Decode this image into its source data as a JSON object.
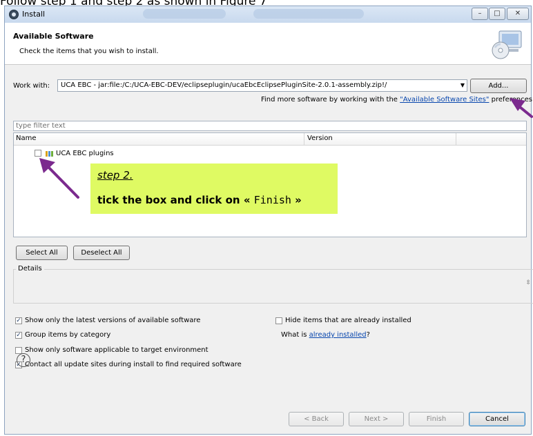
{
  "caption": "Follow step 1 and step 2 as shown in Figure 7",
  "window": {
    "title": "Install",
    "minimize": "–",
    "maximize": "□",
    "close": "✕"
  },
  "header": {
    "title": "Available Software",
    "description": "Check the items that you wish to install."
  },
  "work_with": {
    "label": "Work with:",
    "value": "UCA EBC - jar:file:/C:/UCA-EBC-DEV/eclipseplugin/ucaEbcEclipsePluginSite-2.0.1-assembly.zip!/",
    "add_button": "Add...",
    "hint_prefix": "Find more software by working with the",
    "hint_link": "\"Available Software Sites\"",
    "hint_suffix": "preferences."
  },
  "filter": {
    "placeholder": "type filter text"
  },
  "tree": {
    "columns": [
      "Name",
      "Version"
    ],
    "items": [
      {
        "label": "UCA EBC plugins",
        "checked": false
      }
    ]
  },
  "callout": {
    "step": "step 2.",
    "text": "tick the box and click on «",
    "code": "Finish",
    "close_quote": "»"
  },
  "selection_buttons": {
    "select_all": "Select All",
    "deselect_all": "Deselect All"
  },
  "details": {
    "label": "Details"
  },
  "options": {
    "latest_only": {
      "label": "Show only the latest versions of available software",
      "checked": true
    },
    "hide_installed": {
      "label": "Hide items that are already installed",
      "checked": false
    },
    "group_by_category": {
      "label": "Group items by category",
      "checked": true
    },
    "what_is_prefix": "What is",
    "what_is_link": "already installed",
    "what_is_suffix": "?",
    "target_env": {
      "label": "Show only software applicable to target environment",
      "checked": false
    },
    "contact_sites": {
      "label": "Contact all update sites during install to find required software",
      "checked": true
    }
  },
  "footer": {
    "help": "?",
    "back": "< Back",
    "next": "Next >",
    "finish": "Finish",
    "cancel": "Cancel"
  },
  "colors": {
    "callout": "#dffa63",
    "arrow": "#7b2a8e",
    "link": "#0645ad"
  }
}
